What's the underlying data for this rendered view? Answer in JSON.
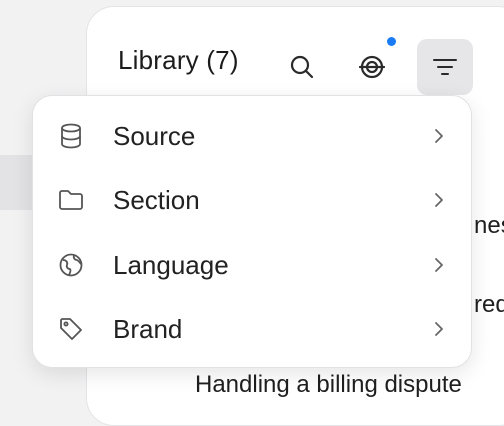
{
  "library": {
    "title": "Library (7)"
  },
  "header_icons": {
    "search": "search-icon",
    "signal": "signal-icon",
    "filter": "filter-icon",
    "notification_color": "#1a7cf5"
  },
  "background_rows": {
    "fragment_1": "nes",
    "fragment_2": "req",
    "last_row": "Handling a billing dispute"
  },
  "filter_menu": {
    "items": [
      {
        "label": "Source",
        "icon": "database-icon"
      },
      {
        "label": "Section",
        "icon": "folder-icon"
      },
      {
        "label": "Language",
        "icon": "globe-icon"
      },
      {
        "label": "Brand",
        "icon": "tag-icon"
      }
    ]
  }
}
